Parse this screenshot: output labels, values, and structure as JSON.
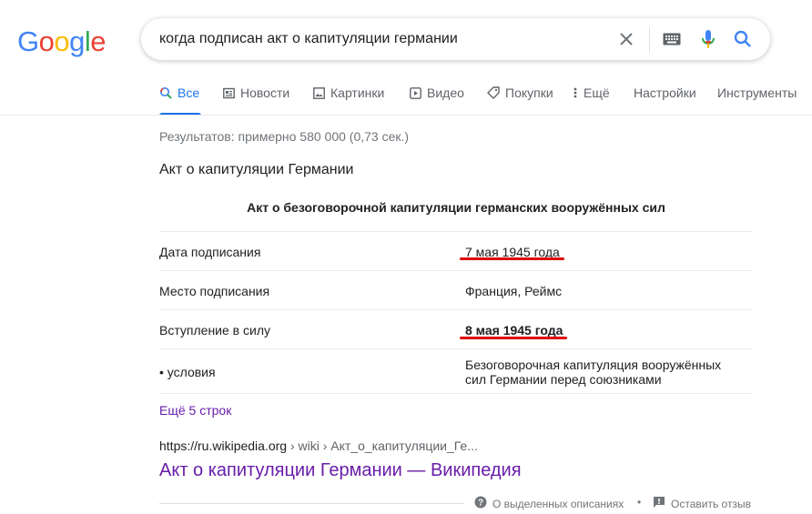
{
  "logo": {
    "letters": [
      "G",
      "o",
      "o",
      "g",
      "l",
      "e"
    ],
    "colors": [
      "#4285f4",
      "#ea4335",
      "#fbbc05",
      "#4285f4",
      "#34a853",
      "#ea4335"
    ]
  },
  "search": {
    "query": "когда подписан акт о капитуляции германии"
  },
  "tabs": [
    {
      "label": "Все",
      "icon": "search-icon",
      "active": true
    },
    {
      "label": "Новости",
      "icon": "news-icon"
    },
    {
      "label": "Картинки",
      "icon": "image-icon"
    },
    {
      "label": "Видео",
      "icon": "video-icon"
    },
    {
      "label": "Покупки",
      "icon": "tag-icon"
    },
    {
      "label": "Ещё",
      "icon": "more-vert-icon"
    },
    {
      "label": "Настройки"
    },
    {
      "label": "Инструменты"
    }
  ],
  "stats": "Результатов: примерно 580 000 (0,73 сек.)",
  "panel": {
    "title": "Акт о капитуляции Германии",
    "heading": "Акт о безоговорочной капитуляции германских вооружённых сил",
    "rows": [
      {
        "key": "Дата подписания",
        "value": "7 мая 1945 года",
        "underlined": true
      },
      {
        "key": "Место подписания",
        "value": "Франция, Реймс"
      },
      {
        "key": "Вступление в силу",
        "value": "8 мая 1945 года",
        "bold": true,
        "underlined": true
      },
      {
        "key": "• условия",
        "value_line1": "Безоговорочная капитуляция вооружённых",
        "value_line2": "сил Германии перед союзниками"
      }
    ],
    "more_link": "Ещё 5 строк",
    "underline_color": "#e00000"
  },
  "result": {
    "url": "https://ru.wikipedia.org",
    "crumb": " › wiki › Акт_о_капитуляции_Ге...",
    "title": "Акт о капитуляции Германии — Википедия"
  },
  "footer": {
    "about": "О выделенных описаниях",
    "separator": "•",
    "feedback": "Оставить отзыв"
  }
}
